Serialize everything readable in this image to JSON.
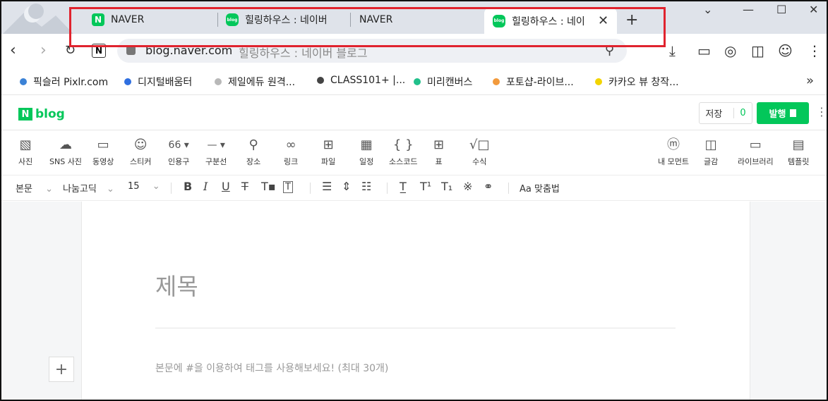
{
  "tabs": [
    {
      "label": "NAVER",
      "icon": "N"
    },
    {
      "label": "힐링하우스 : 네이버",
      "icon": "blog"
    },
    {
      "label": "NAVER"
    },
    {
      "label": "힐링하우스 : 네이",
      "icon": "blog"
    }
  ],
  "window": {
    "new_tab": "+",
    "minimize": "⌄",
    "maximize": "—",
    "restore": "☐",
    "close": "✕"
  },
  "address": {
    "url": "blog.naver.com",
    "page_title": "힐링하우스 : 네이버 블로그",
    "site_badge": "N"
  },
  "bookmarks": [
    {
      "label": "픽슬러 Pixlr.com",
      "color": "#3b82d6"
    },
    {
      "label": "디지털배움터",
      "color": "#2f6fe0"
    },
    {
      "label": "제일에듀 원격...",
      "color": "#b8b8b8"
    },
    {
      "label": "CLASS101+ |...",
      "color": "#444444"
    },
    {
      "label": "미리캔버스",
      "color": "#21c08b"
    },
    {
      "label": "포토샵-라이브...",
      "color": "#f29a3c"
    },
    {
      "label": "카카오 뷰 창작...",
      "color": "#f2d400"
    }
  ],
  "blog": {
    "logo_n": "N",
    "logo_text": "blog",
    "save_label": "저장",
    "save_count": "0",
    "publish_label": "발행"
  },
  "insert_tools": [
    {
      "label": "사진",
      "glyph": "▧"
    },
    {
      "label": "SNS 사진",
      "glyph": "☁"
    },
    {
      "label": "동영상",
      "glyph": "▭"
    },
    {
      "label": "스티커",
      "glyph": "☺"
    },
    {
      "label": "인용구",
      "glyph": "66 ▾"
    },
    {
      "label": "구분선",
      "glyph": "— ▾"
    },
    {
      "label": "장소",
      "glyph": "⚲"
    },
    {
      "label": "링크",
      "glyph": "∞"
    },
    {
      "label": "파일",
      "glyph": "⊞"
    },
    {
      "label": "일정",
      "glyph": "▦"
    },
    {
      "label": "소스코드",
      "glyph": "{ }"
    },
    {
      "label": "표",
      "glyph": "⊞"
    },
    {
      "label": "수식",
      "glyph": "√□"
    },
    {
      "label": "내 모먼트",
      "glyph": "ⓜ"
    },
    {
      "label": "글감",
      "glyph": "◫"
    },
    {
      "label": "라이브러리",
      "glyph": "▭"
    },
    {
      "label": "템플릿",
      "glyph": "▤"
    }
  ],
  "format": {
    "paragraph": "본문",
    "font": "나눔고딕",
    "size": "15",
    "spellcheck": "맞춤법"
  },
  "editor": {
    "title_placeholder": "제목",
    "body_placeholder": "본문에 #을 이용하여 태그를 사용해보세요! (최대 30개)",
    "add_button": "+"
  }
}
